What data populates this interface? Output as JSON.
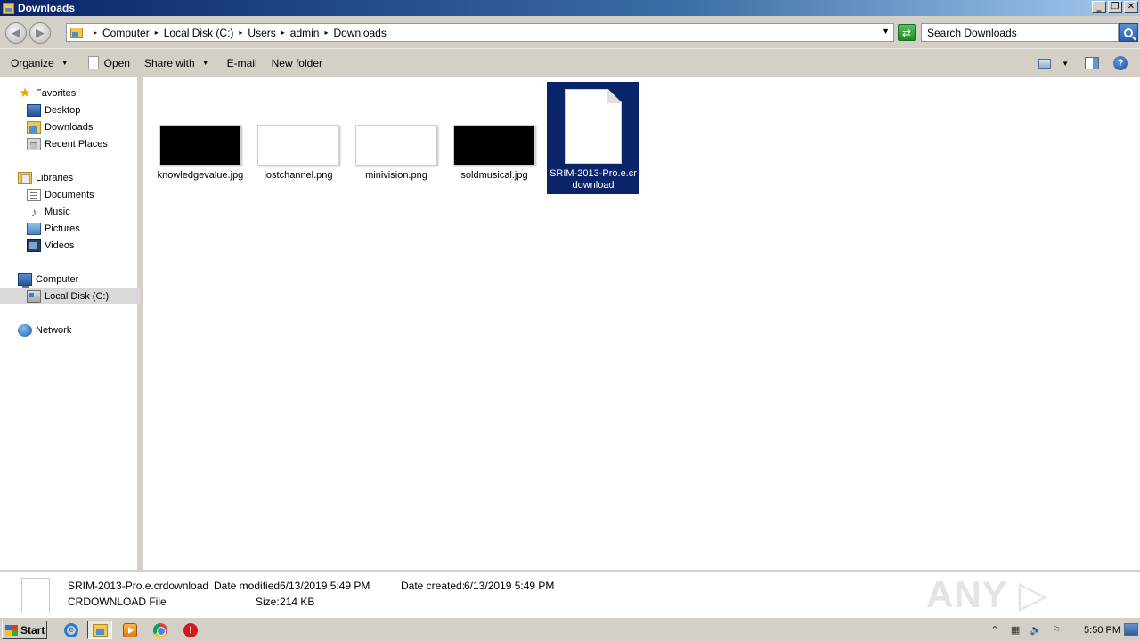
{
  "window": {
    "title": "Downloads",
    "min_glyph": "_",
    "max_glyph": "❐",
    "close_glyph": "✕"
  },
  "address": {
    "crumbs": [
      "Computer",
      "Local Disk (C:)",
      "Users",
      "admin",
      "Downloads"
    ],
    "search_placeholder": "Search Downloads"
  },
  "toolbar": {
    "organize": "Organize",
    "open": "Open",
    "share_with": "Share with",
    "email": "E-mail",
    "new_folder": "New folder",
    "help": "?"
  },
  "nav": {
    "favorites": "Favorites",
    "desktop": "Desktop",
    "downloads": "Downloads",
    "recent_places": "Recent Places",
    "libraries": "Libraries",
    "documents": "Documents",
    "music": "Music",
    "pictures": "Pictures",
    "videos": "Videos",
    "computer": "Computer",
    "local_disk": "Local Disk (C:)",
    "network": "Network"
  },
  "files": [
    {
      "name": "knowledgevalue.jpg",
      "thumb": "black"
    },
    {
      "name": "lostchannel.png",
      "thumb": "white"
    },
    {
      "name": "minivision.png",
      "thumb": "white"
    },
    {
      "name": "soldmusical.jpg",
      "thumb": "black"
    },
    {
      "name": "SRIM-2013-Pro.e.crdownload",
      "thumb": "document",
      "selected": true
    }
  ],
  "details": {
    "filename": "SRIM-2013-Pro.e.crdownload",
    "filetype": "CRDOWNLOAD File",
    "date_modified_label": "Date modified:",
    "date_modified": "6/13/2019 5:49 PM",
    "date_created_label": "Date created:",
    "date_created": "6/13/2019 5:49 PM",
    "size_label": "Size:",
    "size": "214 KB"
  },
  "watermark": "ANY ▷ RUN",
  "taskbar": {
    "start": "Start",
    "clock": "5:50 PM"
  },
  "colors": {
    "selection": "#0a246a",
    "titlebar": "#0a246a",
    "chrome": "#d4d0c8"
  }
}
